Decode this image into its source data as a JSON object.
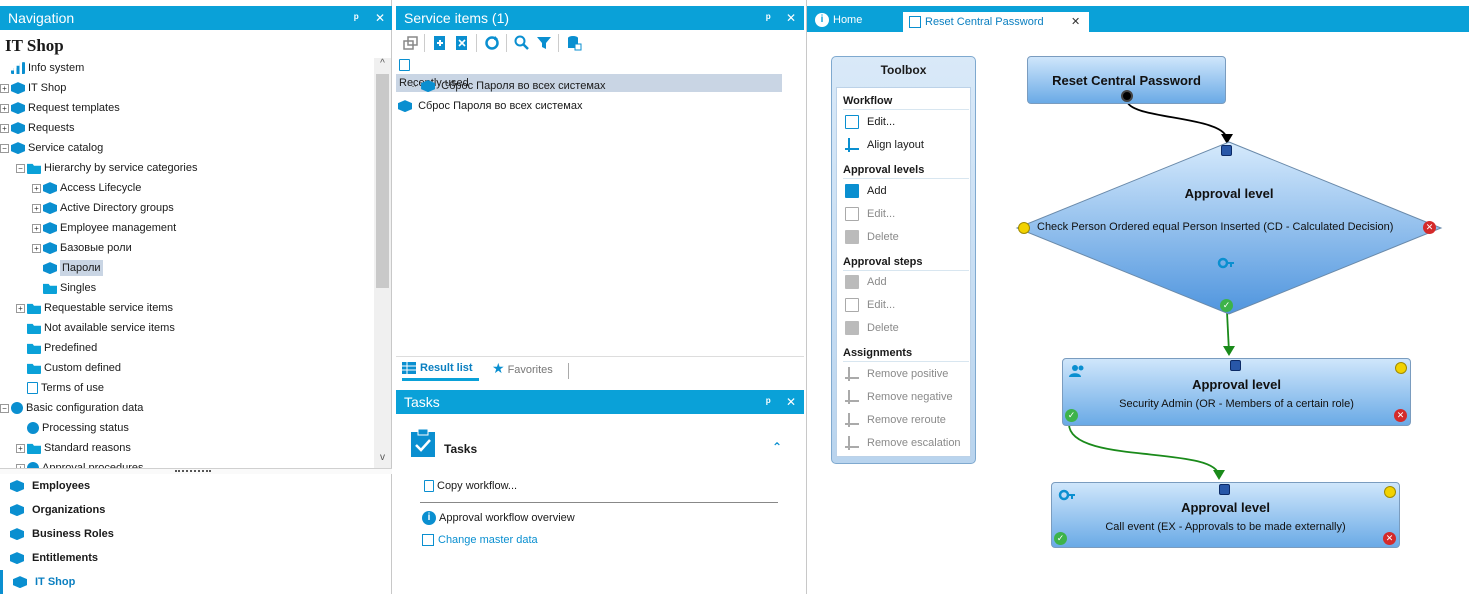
{
  "navigation": {
    "title": "Navigation",
    "pin": "ᵖ",
    "close": "✕",
    "heading": "IT Shop",
    "tree": [
      {
        "label": "Info system",
        "depth": 0,
        "expander": "",
        "icon": "chart-icon"
      },
      {
        "label": "IT Shop",
        "depth": 0,
        "expander": "+",
        "icon": "cart-icon"
      },
      {
        "label": "Request templates",
        "depth": 0,
        "expander": "+",
        "icon": "template-icon"
      },
      {
        "label": "Requests",
        "depth": 0,
        "expander": "+",
        "icon": "requests-icon"
      },
      {
        "label": "Service catalog",
        "depth": 0,
        "expander": "−",
        "icon": "cube-icon"
      },
      {
        "label": "Hierarchy by service categories",
        "depth": 1,
        "expander": "−",
        "icon": "folder-icon"
      },
      {
        "label": "Access Lifecycle",
        "depth": 2,
        "expander": "+",
        "icon": "category-icon"
      },
      {
        "label": "Active Directory groups",
        "depth": 2,
        "expander": "+",
        "icon": "category-icon"
      },
      {
        "label": "Employee management",
        "depth": 2,
        "expander": "+",
        "icon": "category-icon"
      },
      {
        "label": "Базовые роли",
        "depth": 2,
        "expander": "+",
        "icon": "category-icon"
      },
      {
        "label": "Пароли",
        "depth": 2,
        "expander": "",
        "icon": "category-icon",
        "selected": true
      },
      {
        "label": "Singles",
        "depth": 2,
        "expander": "",
        "icon": "folder-icon"
      },
      {
        "label": "Requestable service items",
        "depth": 1,
        "expander": "+",
        "icon": "folder-icon"
      },
      {
        "label": "Not available service items",
        "depth": 1,
        "expander": "",
        "icon": "folder-icon"
      },
      {
        "label": "Predefined",
        "depth": 1,
        "expander": "",
        "icon": "folder-icon"
      },
      {
        "label": "Custom defined",
        "depth": 1,
        "expander": "",
        "icon": "folder-icon"
      },
      {
        "label": "Terms of use",
        "depth": 1,
        "expander": "",
        "icon": "doc-icon"
      },
      {
        "label": "Basic configuration data",
        "depth": 0,
        "expander": "−",
        "icon": "gear-icon"
      },
      {
        "label": "Processing status",
        "depth": 1,
        "expander": "",
        "icon": "gear-icon"
      },
      {
        "label": "Standard reasons",
        "depth": 1,
        "expander": "+",
        "icon": "folder-icon"
      },
      {
        "label": "Approval procedures",
        "depth": 1,
        "expander": "+",
        "icon": "gear-icon"
      }
    ],
    "scroll_up": "^",
    "scroll_down": "v",
    "bottom_items": [
      {
        "label": "Employees",
        "icon": "person-icon"
      },
      {
        "label": "Organizations",
        "icon": "org-icon"
      },
      {
        "label": "Business Roles",
        "icon": "business-roles-icon"
      },
      {
        "label": "Entitlements",
        "icon": "entitlements-icon"
      },
      {
        "label": "IT Shop",
        "icon": "cart-icon",
        "active": true
      }
    ]
  },
  "service_items": {
    "title": "Service items (1)",
    "pin": "ᵖ",
    "close": "✕",
    "recently_used": "Recently used",
    "recent_item": "Сброс Пароля во всех системах",
    "item": "Сброс Пароля во всех системах",
    "tabs": [
      {
        "label": "Result list",
        "icon": "grid-icon",
        "active": true
      },
      {
        "label": "Favorites",
        "icon": "star-icon",
        "active": false
      }
    ]
  },
  "tasks": {
    "title": "Tasks",
    "pin": "ᵖ",
    "close": "✕",
    "group_title": "Tasks",
    "collapse": "⌃",
    "copy_workflow": "Copy workflow...",
    "overview": "Approval workflow overview",
    "change_master": "Change master data"
  },
  "doc_tabs": [
    {
      "label": "Home",
      "icon": "info-icon",
      "active": false
    },
    {
      "label": "Reset Central Password",
      "icon": "edit-icon",
      "active": true,
      "close": "✕"
    }
  ],
  "toolbox": {
    "title": "Toolbox",
    "sections": {
      "workflow": "Workflow",
      "approval_levels": "Approval levels",
      "approval_steps": "Approval steps",
      "assignments": "Assignments"
    },
    "workflow_edit": "Edit...",
    "align_layout": "Align layout",
    "levels_add": "Add",
    "levels_edit": "Edit...",
    "levels_delete": "Delete",
    "steps_add": "Add",
    "steps_edit": "Edit...",
    "steps_delete": "Delete",
    "remove_positive": "Remove positive",
    "remove_negative": "Remove negative",
    "remove_reroute": "Remove reroute",
    "remove_escalation": "Remove escalation"
  },
  "workflow": {
    "start_title": "Reset Central Password",
    "diamond_title": "Approval level",
    "diamond_step": "Check Person Ordered equal Person Inserted (CD - Calculated Decision)",
    "level2_title": "Approval level",
    "level2_step": "Security Admin (OR - Members of a certain role)",
    "level3_title": "Approval level",
    "level3_step": "Call event (EX - Approvals to be made externally)",
    "ok_mark": "✓",
    "x_mark": "✕",
    "colors": {
      "positive": "#1a8a1a",
      "start_link": "#000000"
    }
  }
}
